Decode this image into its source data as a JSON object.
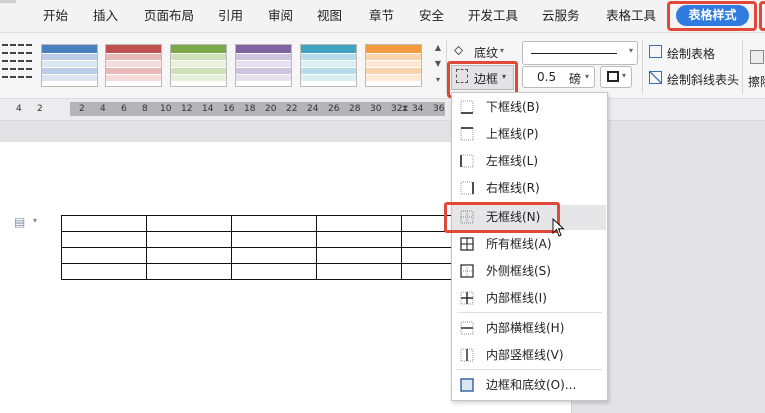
{
  "menubar": {
    "items": [
      "开始",
      "插入",
      "页面布局",
      "引用",
      "审阅",
      "视图",
      "章节",
      "安全",
      "开发工具",
      "云服务",
      "表格工具"
    ],
    "active_tab": "表格样式"
  },
  "ribbon": {
    "shading_label": "底纹",
    "border_label": "边框",
    "line_weight_value": "0.5",
    "line_weight_unit": "磅",
    "draw_table": "绘制表格",
    "draw_diagonal": "绘制斜线表头",
    "erase_partial": "擦除",
    "style_colors": [
      "#4a7fc0",
      "#c0504d",
      "#7ba848",
      "#8064a2",
      "#41a3c2",
      "#f59a3e"
    ]
  },
  "ruler": {
    "numbers": [
      "4",
      "2",
      "2",
      "4",
      "6",
      "8",
      "10",
      "12",
      "14",
      "16",
      "18",
      "20",
      "22",
      "24",
      "26",
      "28",
      "30",
      "32",
      "34",
      "36"
    ]
  },
  "dropdown": {
    "items": [
      {
        "label": "下框线(B)",
        "icon": "border-bottom-icon"
      },
      {
        "label": "上框线(P)",
        "icon": "border-top-icon"
      },
      {
        "label": "左框线(L)",
        "icon": "border-left-icon"
      },
      {
        "label": "右框线(R)",
        "icon": "border-right-icon"
      },
      {
        "label": "无框线(N)",
        "icon": "border-none-icon"
      },
      {
        "label": "所有框线(A)",
        "icon": "border-all-icon"
      },
      {
        "label": "外侧框线(S)",
        "icon": "border-outside-icon"
      },
      {
        "label": "内部框线(I)",
        "icon": "border-inside-icon"
      },
      {
        "label": "内部横框线(H)",
        "icon": "border-inside-horizontal-icon"
      },
      {
        "label": "内部竖框线(V)",
        "icon": "border-inside-vertical-icon"
      },
      {
        "label": "边框和底纹(O)...",
        "icon": "borders-and-shading-icon"
      }
    ]
  }
}
